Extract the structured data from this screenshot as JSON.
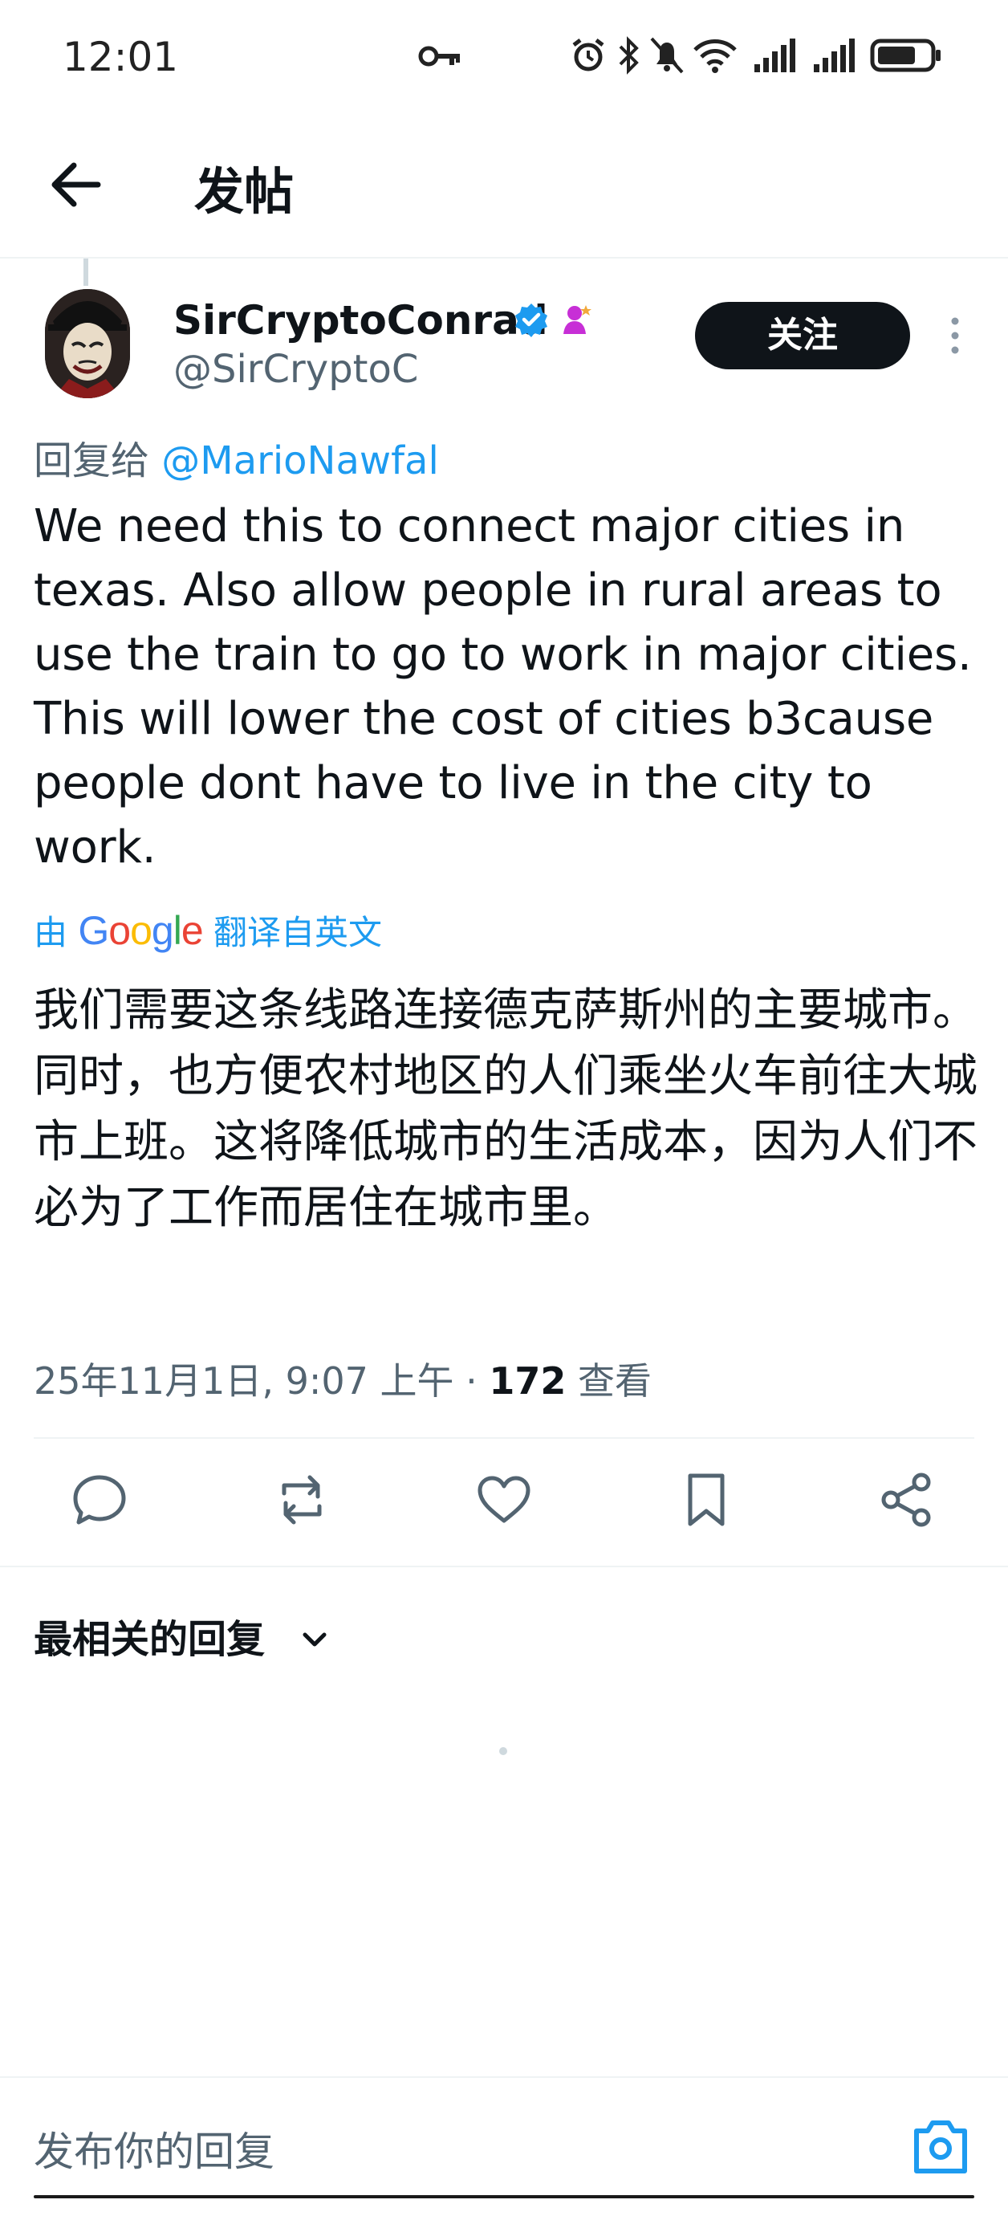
{
  "status_bar": {
    "time": "12:01",
    "icons": [
      "key-icon",
      "alarm-icon",
      "bluetooth-icon",
      "mute-icon",
      "wifi-icon",
      "signal-icon",
      "signal-icon",
      "battery-icon"
    ]
  },
  "header": {
    "title": "发帖"
  },
  "post": {
    "author": {
      "display_name": "SirCryptoConrad",
      "handle": "@SirCryptoC"
    },
    "follow_label": "关注",
    "reply_to_prefix": "回复给",
    "reply_to_mention": "@MarioNawfal",
    "text": "We need this to connect major cities in texas. Also allow people in rural areas to use the train to go to work in major cities. This will lower the cost of cities b3cause people dont have to live in the city to work.",
    "translate": {
      "by_prefix": "由",
      "provider": "Google",
      "suffix": "翻译自英文"
    },
    "translated_text": "我们需要这条线路连接德克萨斯州的主要城市。同时，也方便农村地区的人们乘坐火车前往大城市上班。这将降低城市的生活成本，因为人们不必为了工作而居住在城市里。",
    "timestamp": "25年11月1日, 9:07 上午",
    "separator": "·",
    "views_count": "172",
    "views_label": "查看"
  },
  "actions": {
    "icons": [
      "reply-icon",
      "repost-icon",
      "like-icon",
      "bookmark-icon",
      "share-icon"
    ]
  },
  "replies": {
    "sort_label": "最相关的回复"
  },
  "composer": {
    "placeholder": "发布你的回复"
  },
  "colors": {
    "accent": "#1d9bf0",
    "text_primary": "#0f1419",
    "text_secondary": "#536471",
    "follow_button_bg": "#0f1419"
  }
}
